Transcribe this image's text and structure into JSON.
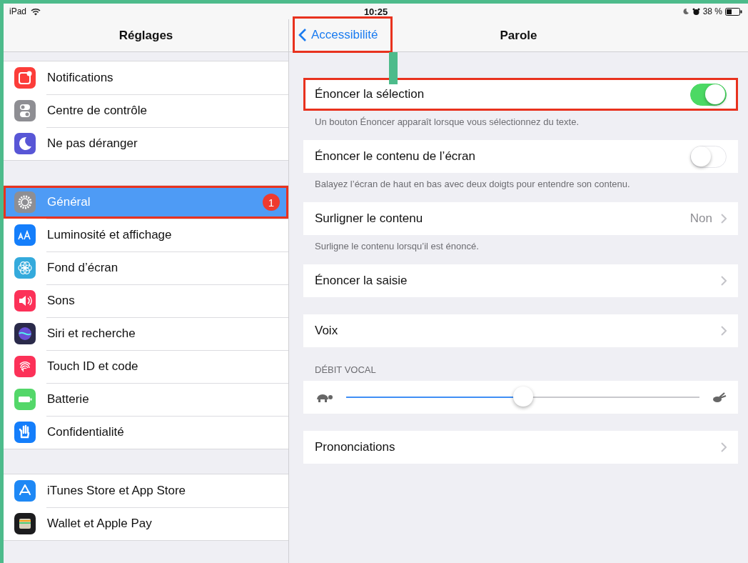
{
  "status_bar": {
    "device": "iPad",
    "time": "10:25",
    "battery": "38 %"
  },
  "sidebar": {
    "title": "Réglages",
    "groups": [
      [
        {
          "label": "Notifications",
          "kind": "notifications",
          "color": "#fc3d39",
          "selected": false,
          "highlighted": false
        },
        {
          "label": "Centre de contrôle",
          "kind": "toggles",
          "color": "#8e8e93",
          "selected": false,
          "highlighted": false
        },
        {
          "label": "Ne pas déranger",
          "kind": "moon",
          "color": "#5856d6",
          "selected": false,
          "highlighted": false
        }
      ],
      [
        {
          "label": "Général",
          "kind": "gear",
          "color": "#8e8e93",
          "selected": true,
          "highlighted": true,
          "badge": "1"
        },
        {
          "label": "Luminosité et affichage",
          "kind": "letters",
          "color": "#147efb",
          "selected": false,
          "highlighted": false
        },
        {
          "label": "Fond d’écran",
          "kind": "flower",
          "color": "#34aadc",
          "selected": false,
          "highlighted": false
        },
        {
          "label": "Sons",
          "kind": "speaker",
          "color": "#fc3158",
          "selected": false,
          "highlighted": false
        },
        {
          "label": "Siri et recherche",
          "kind": "orb",
          "color": "#2a2a4a",
          "selected": false,
          "highlighted": false
        },
        {
          "label": "Touch ID et code",
          "kind": "fingerprint",
          "color": "#fc3158",
          "selected": false,
          "highlighted": false
        },
        {
          "label": "Batterie",
          "kind": "battery",
          "color": "#53d769",
          "selected": false,
          "highlighted": false
        },
        {
          "label": "Confidentialité",
          "kind": "hand",
          "color": "#147efb",
          "selected": false,
          "highlighted": false
        }
      ],
      [
        {
          "label": "iTunes Store et App Store",
          "kind": "appstore",
          "color": "#1e88f5",
          "selected": false,
          "highlighted": false
        },
        {
          "label": "Wallet et Apple Pay",
          "kind": "wallet",
          "color": "#1c1c1e",
          "selected": false,
          "highlighted": false
        }
      ]
    ]
  },
  "detail": {
    "back": {
      "label": "Accessibilité",
      "highlighted": true
    },
    "title": "Parole",
    "groups": [
      {
        "rows": [
          {
            "kind": "switch",
            "label": "Énoncer la sélection",
            "on": true,
            "highlighted": true
          }
        ],
        "footer": "Un bouton Énoncer apparaît lorsque vous sélectionnez du texte."
      },
      {
        "rows": [
          {
            "kind": "switch",
            "label": "Énoncer le contenu de l’écran",
            "on": false,
            "highlighted": false
          }
        ],
        "footer": "Balayez l’écran de haut en bas avec deux doigts pour entendre son contenu."
      },
      {
        "rows": [
          {
            "kind": "value",
            "label": "Surligner le contenu",
            "value": "Non",
            "highlighted": false
          }
        ],
        "footer": "Surligne le contenu lorsqu’il est énoncé."
      },
      {
        "rows": [
          {
            "kind": "link",
            "label": "Énoncer la saisie",
            "highlighted": false
          }
        ]
      },
      {
        "rows": [
          {
            "kind": "link",
            "label": "Voix",
            "highlighted": false
          }
        ]
      },
      {
        "header": "DÉBIT VOCAL",
        "rows": [
          {
            "kind": "slider",
            "level": 0.5,
            "highlighted": false
          }
        ]
      },
      {
        "rows": [
          {
            "kind": "link",
            "label": "Prononciations",
            "highlighted": false
          }
        ]
      }
    ]
  }
}
